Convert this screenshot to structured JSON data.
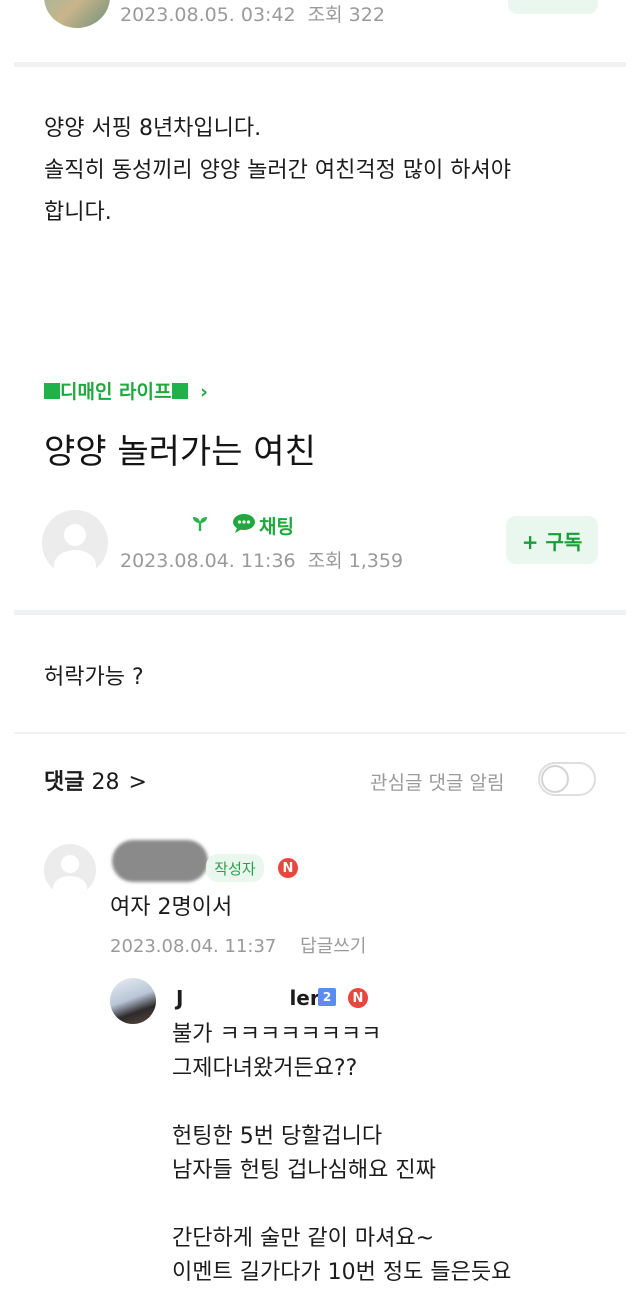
{
  "top_post": {
    "meta_date": "2023.08.05. 03:42",
    "meta_views": "조회 322",
    "body_lines": [
      "양양 서핑 8년차입니다.",
      "솔직히 동성끼리 양양 놀러간 여친걱정 많이 하셔야",
      "합니다."
    ]
  },
  "embedded_post": {
    "category": "디매인 라이프",
    "category_arrow": "›",
    "title": "양양 놀러가는 여친",
    "chat_label": "채팅",
    "meta_date": "2023.08.04. 11:36",
    "meta_views": "조회 1,359",
    "subscribe_label": "+ 구독",
    "body": "허락가능 ?"
  },
  "comments_header": {
    "label": "댓글",
    "count": "28",
    "chevron": ">",
    "notify_label": "관심글 댓글 알림",
    "notify_on": false
  },
  "comments": [
    {
      "author_badge": "작성자",
      "n_badge": "N",
      "text": "여자 2명이서",
      "date": "2023.08.04. 11:37",
      "reply_label": "답글쓰기"
    }
  ],
  "reply": {
    "author_partial_start": "J",
    "author_partial_end": "ler",
    "level_badge": "2",
    "n_badge": "N",
    "lines": [
      "불가 ㅋㅋㅋㅋㅋㅋㅋㅋ",
      "그제다녀왔거든요??",
      "",
      "헌팅한 5번 당할겁니다",
      "남자들 헌팅 겁나심해요 진짜",
      "",
      "간단하게 술만 같이 마셔요~",
      "이멘트 길가다가 10번 정도 들은듯요"
    ]
  }
}
